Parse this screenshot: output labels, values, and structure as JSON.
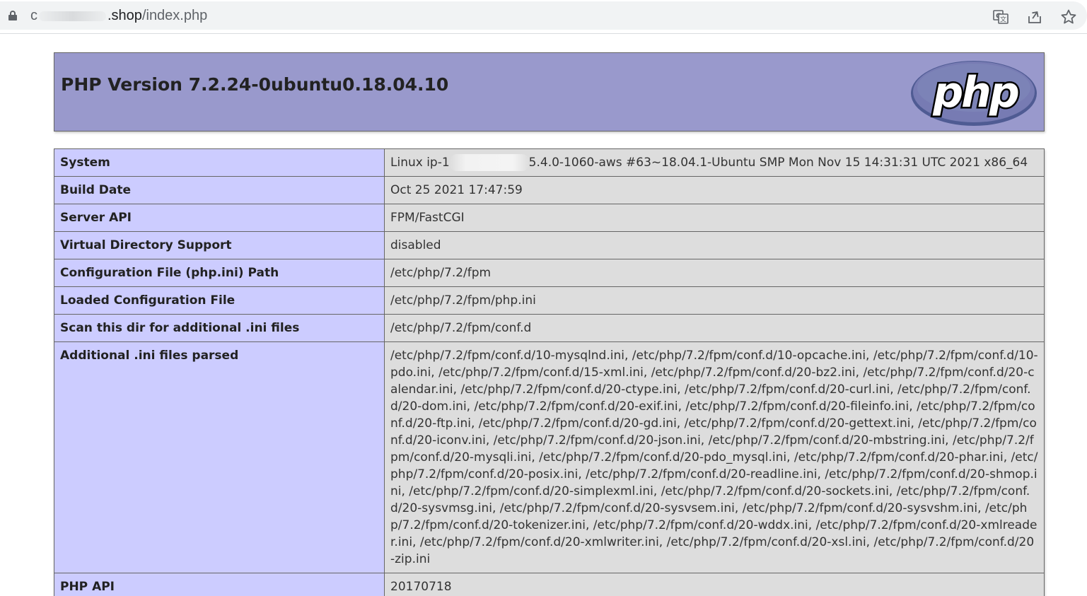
{
  "browser": {
    "url_prefix": "c",
    "url_domain_suffix": ".shop",
    "url_path": "/index.php",
    "icons": [
      "lock-icon",
      "translate-icon",
      "share-icon",
      "bookmark-star-icon"
    ]
  },
  "header": {
    "title": "PHP Version 7.2.24-0ubuntu0.18.04.10",
    "logo_text": "php"
  },
  "rows": [
    {
      "key": "System",
      "value_prefix": "Linux ip-1",
      "value_suffix": "5.4.0-1060-aws #63~18.04.1-Ubuntu SMP Mon Nov 15 14:31:31 UTC 2021 x86_64"
    },
    {
      "key": "Build Date",
      "value": "Oct 25 2021 17:47:59"
    },
    {
      "key": "Server API",
      "value": "FPM/FastCGI"
    },
    {
      "key": "Virtual Directory Support",
      "value": "disabled"
    },
    {
      "key": "Configuration File (php.ini) Path",
      "value": "/etc/php/7.2/fpm"
    },
    {
      "key": "Loaded Configuration File",
      "value": "/etc/php/7.2/fpm/php.ini"
    },
    {
      "key": "Scan this dir for additional .ini files",
      "value": "/etc/php/7.2/fpm/conf.d"
    },
    {
      "key": "Additional .ini files parsed",
      "value": "/etc/php/7.2/fpm/conf.d/10-mysqlnd.ini, /etc/php/7.2/fpm/conf.d/10-opcache.ini, /etc/php/7.2/fpm/conf.d/10-pdo.ini, /etc/php/7.2/fpm/conf.d/15-xml.ini, /etc/php/7.2/fpm/conf.d/20-bz2.ini, /etc/php/7.2/fpm/conf.d/20-calendar.ini, /etc/php/7.2/fpm/conf.d/20-ctype.ini, /etc/php/7.2/fpm/conf.d/20-curl.ini, /etc/php/7.2/fpm/conf.d/20-dom.ini, /etc/php/7.2/fpm/conf.d/20-exif.ini, /etc/php/7.2/fpm/conf.d/20-fileinfo.ini, /etc/php/7.2/fpm/conf.d/20-ftp.ini, /etc/php/7.2/fpm/conf.d/20-gd.ini, /etc/php/7.2/fpm/conf.d/20-gettext.ini, /etc/php/7.2/fpm/conf.d/20-iconv.ini, /etc/php/7.2/fpm/conf.d/20-json.ini, /etc/php/7.2/fpm/conf.d/20-mbstring.ini, /etc/php/7.2/fpm/conf.d/20-mysqli.ini, /etc/php/7.2/fpm/conf.d/20-pdo_mysql.ini, /etc/php/7.2/fpm/conf.d/20-phar.ini, /etc/php/7.2/fpm/conf.d/20-posix.ini, /etc/php/7.2/fpm/conf.d/20-readline.ini, /etc/php/7.2/fpm/conf.d/20-shmop.ini, /etc/php/7.2/fpm/conf.d/20-simplexml.ini, /etc/php/7.2/fpm/conf.d/20-sockets.ini, /etc/php/7.2/fpm/conf.d/20-sysvmsg.ini, /etc/php/7.2/fpm/conf.d/20-sysvsem.ini, /etc/php/7.2/fpm/conf.d/20-sysvshm.ini, /etc/php/7.2/fpm/conf.d/20-tokenizer.ini, /etc/php/7.2/fpm/conf.d/20-wddx.ini, /etc/php/7.2/fpm/conf.d/20-xmlreader.ini, /etc/php/7.2/fpm/conf.d/20-xmlwriter.ini, /etc/php/7.2/fpm/conf.d/20-xsl.ini, /etc/php/7.2/fpm/conf.d/20-zip.ini"
    },
    {
      "key": "PHP API",
      "value": "20170718"
    }
  ],
  "colors": {
    "header_bg": "#9999cc",
    "key_bg": "#ccccff",
    "value_bg": "#dddddd",
    "logo_fill": "#777bb3"
  }
}
